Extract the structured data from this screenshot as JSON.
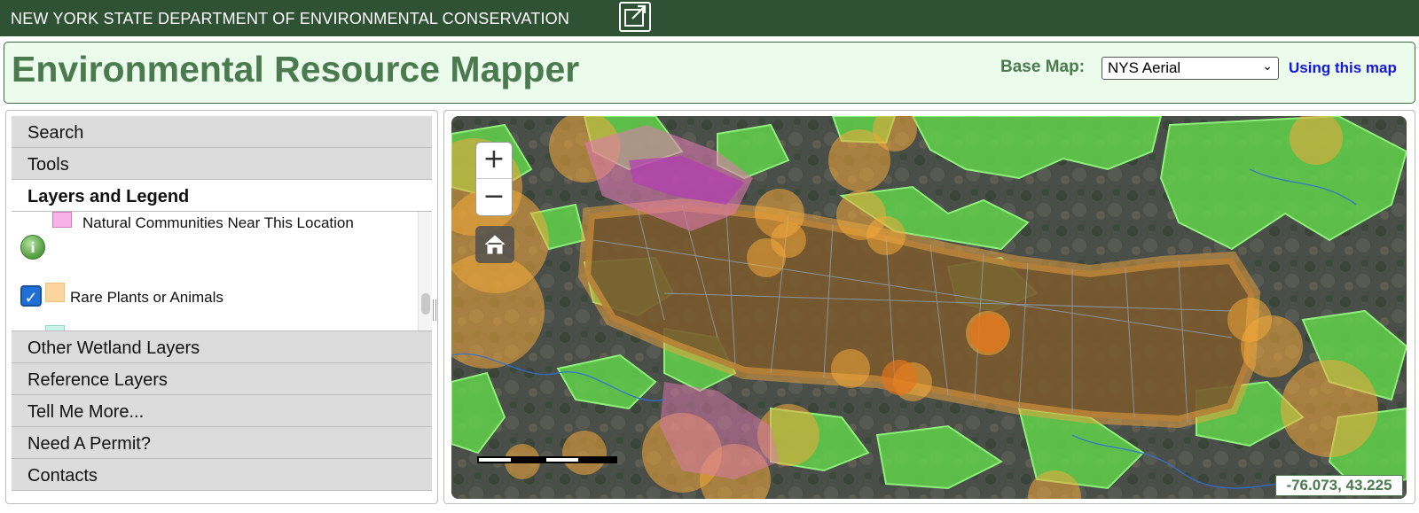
{
  "topbar": {
    "agency": "NEW YORK STATE DEPARTMENT OF ENVIRONMENTAL CONSERVATION",
    "external_icon": "external-link-icon"
  },
  "header": {
    "title": "Environmental Resource Mapper",
    "basemap_label": "Base Map:",
    "basemap_selected": "NYS Aerial",
    "using_link": "Using this map"
  },
  "sidebar": {
    "sections": [
      "Search",
      "Tools",
      "Layers and Legend",
      "Other Wetland Layers",
      "Reference Layers",
      "Tell Me More...",
      "Need A Permit?",
      "Contacts"
    ],
    "active_section": "Layers and Legend",
    "legend": {
      "items": [
        {
          "label": "Natural Communities Near This Location",
          "color": "#f7b3e8",
          "checked": null
        },
        {
          "label": "Rare Plants or Animals",
          "color": "#ffd59e",
          "checked": true
        }
      ],
      "partial_swatch_color": "#c9f3e6"
    }
  },
  "map": {
    "zoom_in": "+",
    "zoom_out": "−",
    "home_icon": "home-icon",
    "coordinates": "-76.073, 43.225",
    "colors": {
      "wetland": "#62d24a",
      "rare": "#f4a93a",
      "natural": "#e06aa0",
      "lake": "#7a5a2e"
    }
  },
  "colors": {
    "brand_green": "#2e5233",
    "title_green": "#4a7a4e",
    "link_blue": "#1515e0"
  }
}
